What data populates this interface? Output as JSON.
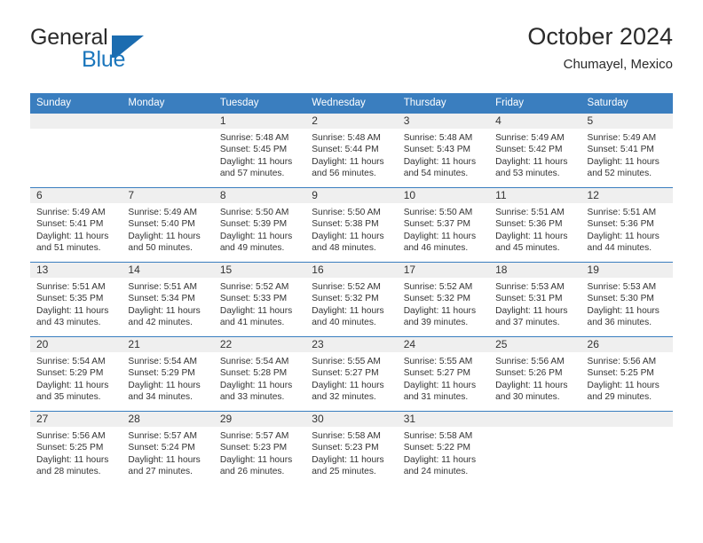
{
  "logo": {
    "word_top": "General",
    "word_bottom": "Blue",
    "mark": "blue-triangle-flag",
    "color_primary": "#1b6cb0",
    "color_text": "#2b2b2b"
  },
  "header": {
    "title": "October 2024",
    "subtitle": "Chumayel, Mexico"
  },
  "colors": {
    "header_blue": "#3a7ebf",
    "daynum_band": "#efefef",
    "text": "#333333"
  },
  "weekday_headers": [
    "Sunday",
    "Monday",
    "Tuesday",
    "Wednesday",
    "Thursday",
    "Friday",
    "Saturday"
  ],
  "weeks": [
    [
      {
        "day": "",
        "sunrise": "",
        "sunset": "",
        "daylight": ""
      },
      {
        "day": "",
        "sunrise": "",
        "sunset": "",
        "daylight": ""
      },
      {
        "day": "1",
        "sunrise": "Sunrise: 5:48 AM",
        "sunset": "Sunset: 5:45 PM",
        "daylight": "Daylight: 11 hours and 57 minutes."
      },
      {
        "day": "2",
        "sunrise": "Sunrise: 5:48 AM",
        "sunset": "Sunset: 5:44 PM",
        "daylight": "Daylight: 11 hours and 56 minutes."
      },
      {
        "day": "3",
        "sunrise": "Sunrise: 5:48 AM",
        "sunset": "Sunset: 5:43 PM",
        "daylight": "Daylight: 11 hours and 54 minutes."
      },
      {
        "day": "4",
        "sunrise": "Sunrise: 5:49 AM",
        "sunset": "Sunset: 5:42 PM",
        "daylight": "Daylight: 11 hours and 53 minutes."
      },
      {
        "day": "5",
        "sunrise": "Sunrise: 5:49 AM",
        "sunset": "Sunset: 5:41 PM",
        "daylight": "Daylight: 11 hours and 52 minutes."
      }
    ],
    [
      {
        "day": "6",
        "sunrise": "Sunrise: 5:49 AM",
        "sunset": "Sunset: 5:41 PM",
        "daylight": "Daylight: 11 hours and 51 minutes."
      },
      {
        "day": "7",
        "sunrise": "Sunrise: 5:49 AM",
        "sunset": "Sunset: 5:40 PM",
        "daylight": "Daylight: 11 hours and 50 minutes."
      },
      {
        "day": "8",
        "sunrise": "Sunrise: 5:50 AM",
        "sunset": "Sunset: 5:39 PM",
        "daylight": "Daylight: 11 hours and 49 minutes."
      },
      {
        "day": "9",
        "sunrise": "Sunrise: 5:50 AM",
        "sunset": "Sunset: 5:38 PM",
        "daylight": "Daylight: 11 hours and 48 minutes."
      },
      {
        "day": "10",
        "sunrise": "Sunrise: 5:50 AM",
        "sunset": "Sunset: 5:37 PM",
        "daylight": "Daylight: 11 hours and 46 minutes."
      },
      {
        "day": "11",
        "sunrise": "Sunrise: 5:51 AM",
        "sunset": "Sunset: 5:36 PM",
        "daylight": "Daylight: 11 hours and 45 minutes."
      },
      {
        "day": "12",
        "sunrise": "Sunrise: 5:51 AM",
        "sunset": "Sunset: 5:36 PM",
        "daylight": "Daylight: 11 hours and 44 minutes."
      }
    ],
    [
      {
        "day": "13",
        "sunrise": "Sunrise: 5:51 AM",
        "sunset": "Sunset: 5:35 PM",
        "daylight": "Daylight: 11 hours and 43 minutes."
      },
      {
        "day": "14",
        "sunrise": "Sunrise: 5:51 AM",
        "sunset": "Sunset: 5:34 PM",
        "daylight": "Daylight: 11 hours and 42 minutes."
      },
      {
        "day": "15",
        "sunrise": "Sunrise: 5:52 AM",
        "sunset": "Sunset: 5:33 PM",
        "daylight": "Daylight: 11 hours and 41 minutes."
      },
      {
        "day": "16",
        "sunrise": "Sunrise: 5:52 AM",
        "sunset": "Sunset: 5:32 PM",
        "daylight": "Daylight: 11 hours and 40 minutes."
      },
      {
        "day": "17",
        "sunrise": "Sunrise: 5:52 AM",
        "sunset": "Sunset: 5:32 PM",
        "daylight": "Daylight: 11 hours and 39 minutes."
      },
      {
        "day": "18",
        "sunrise": "Sunrise: 5:53 AM",
        "sunset": "Sunset: 5:31 PM",
        "daylight": "Daylight: 11 hours and 37 minutes."
      },
      {
        "day": "19",
        "sunrise": "Sunrise: 5:53 AM",
        "sunset": "Sunset: 5:30 PM",
        "daylight": "Daylight: 11 hours and 36 minutes."
      }
    ],
    [
      {
        "day": "20",
        "sunrise": "Sunrise: 5:54 AM",
        "sunset": "Sunset: 5:29 PM",
        "daylight": "Daylight: 11 hours and 35 minutes."
      },
      {
        "day": "21",
        "sunrise": "Sunrise: 5:54 AM",
        "sunset": "Sunset: 5:29 PM",
        "daylight": "Daylight: 11 hours and 34 minutes."
      },
      {
        "day": "22",
        "sunrise": "Sunrise: 5:54 AM",
        "sunset": "Sunset: 5:28 PM",
        "daylight": "Daylight: 11 hours and 33 minutes."
      },
      {
        "day": "23",
        "sunrise": "Sunrise: 5:55 AM",
        "sunset": "Sunset: 5:27 PM",
        "daylight": "Daylight: 11 hours and 32 minutes."
      },
      {
        "day": "24",
        "sunrise": "Sunrise: 5:55 AM",
        "sunset": "Sunset: 5:27 PM",
        "daylight": "Daylight: 11 hours and 31 minutes."
      },
      {
        "day": "25",
        "sunrise": "Sunrise: 5:56 AM",
        "sunset": "Sunset: 5:26 PM",
        "daylight": "Daylight: 11 hours and 30 minutes."
      },
      {
        "day": "26",
        "sunrise": "Sunrise: 5:56 AM",
        "sunset": "Sunset: 5:25 PM",
        "daylight": "Daylight: 11 hours and 29 minutes."
      }
    ],
    [
      {
        "day": "27",
        "sunrise": "Sunrise: 5:56 AM",
        "sunset": "Sunset: 5:25 PM",
        "daylight": "Daylight: 11 hours and 28 minutes."
      },
      {
        "day": "28",
        "sunrise": "Sunrise: 5:57 AM",
        "sunset": "Sunset: 5:24 PM",
        "daylight": "Daylight: 11 hours and 27 minutes."
      },
      {
        "day": "29",
        "sunrise": "Sunrise: 5:57 AM",
        "sunset": "Sunset: 5:23 PM",
        "daylight": "Daylight: 11 hours and 26 minutes."
      },
      {
        "day": "30",
        "sunrise": "Sunrise: 5:58 AM",
        "sunset": "Sunset: 5:23 PM",
        "daylight": "Daylight: 11 hours and 25 minutes."
      },
      {
        "day": "31",
        "sunrise": "Sunrise: 5:58 AM",
        "sunset": "Sunset: 5:22 PM",
        "daylight": "Daylight: 11 hours and 24 minutes."
      },
      {
        "day": "",
        "sunrise": "",
        "sunset": "",
        "daylight": ""
      },
      {
        "day": "",
        "sunrise": "",
        "sunset": "",
        "daylight": ""
      }
    ]
  ]
}
